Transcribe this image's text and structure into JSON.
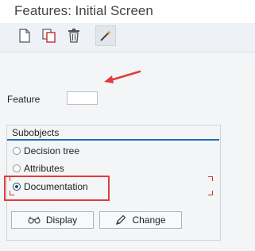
{
  "window": {
    "title": "Features: Initial Screen"
  },
  "toolbar": {
    "items": [
      {
        "icon": "new-document-icon"
      },
      {
        "icon": "copy-icon"
      },
      {
        "icon": "trash-icon"
      },
      {
        "icon": "magic-wand-icon",
        "active": true
      }
    ]
  },
  "form": {
    "feature_label": "Feature",
    "feature_value": ""
  },
  "subobjects": {
    "title": "Subobjects",
    "options": [
      {
        "label": "Decision tree",
        "selected": false
      },
      {
        "label": "Attributes",
        "selected": false
      },
      {
        "label": "Documentation",
        "selected": true
      }
    ]
  },
  "actions": {
    "display_label": "Display",
    "change_label": "Change"
  },
  "annotations": {
    "highlight_color": "#e33b3b"
  },
  "colors": {
    "accent": "#1f6db4",
    "toolbar_bg": "#eef1f5",
    "area_bg": "#f4f5f7"
  }
}
